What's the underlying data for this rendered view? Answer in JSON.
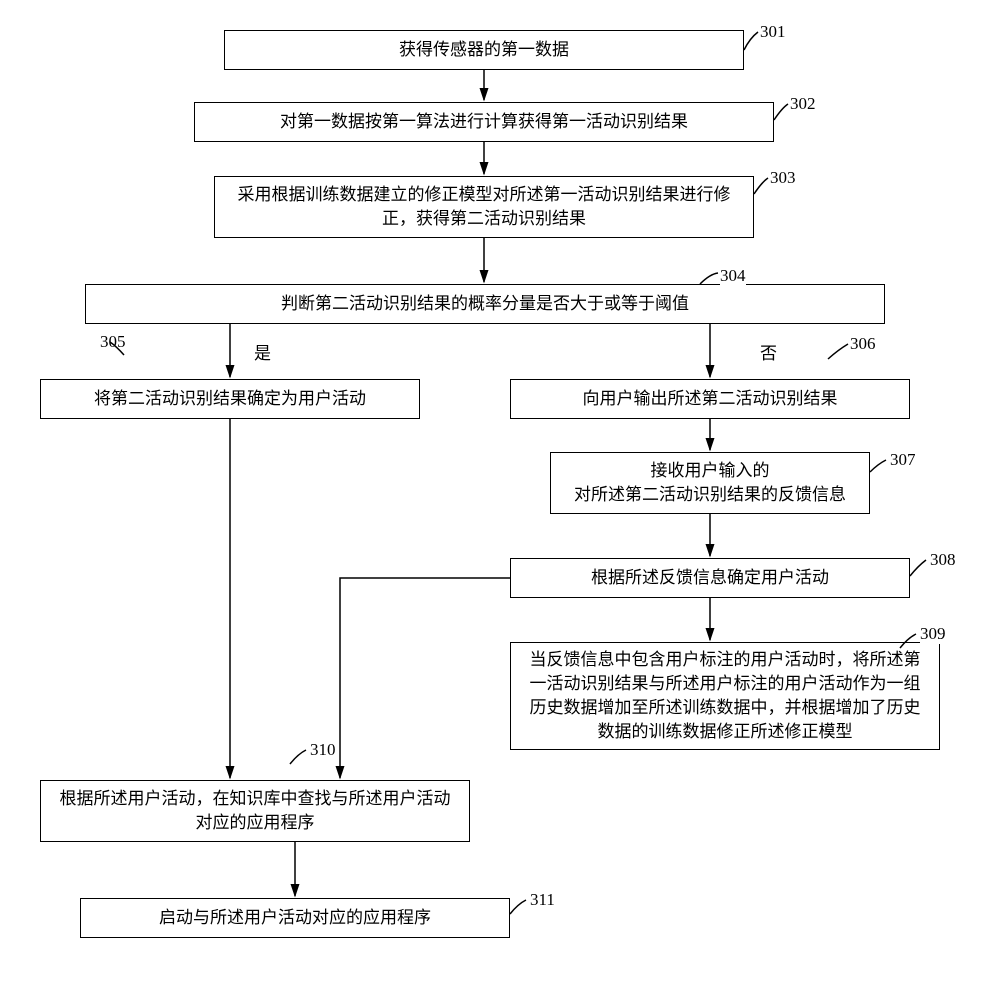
{
  "steps": {
    "s301": {
      "num": "301",
      "text": "获得传感器的第一数据"
    },
    "s302": {
      "num": "302",
      "text": "对第一数据按第一算法进行计算获得第一活动识别结果"
    },
    "s303": {
      "num": "303",
      "text": "采用根据训练数据建立的修正模型对所述第一活动识别结果进行修正，获得第二活动识别结果"
    },
    "s304": {
      "num": "304",
      "text": "判断第二活动识别结果的概率分量是否大于或等于阈值"
    },
    "s305": {
      "num": "305",
      "text": "将第二活动识别结果确定为用户活动"
    },
    "s306": {
      "num": "306",
      "text": "向用户输出所述第二活动识别结果"
    },
    "s307": {
      "num": "307",
      "text_l1": "接收用户输入的",
      "text_l2": "对所述第二活动识别结果的反馈信息"
    },
    "s308": {
      "num": "308",
      "text": "根据所述反馈信息确定用户活动"
    },
    "s309": {
      "num": "309",
      "text": "当反馈信息中包含用户标注的用户活动时，将所述第一活动识别结果与所述用户标注的用户活动作为一组历史数据增加至所述训练数据中，并根据增加了历史数据的训练数据修正所述修正模型"
    },
    "s310": {
      "num": "310",
      "text": "根据所述用户活动，在知识库中查找与所述用户活动对应的应用程序"
    },
    "s311": {
      "num": "311",
      "text": "启动与所述用户活动对应的应用程序"
    }
  },
  "branch": {
    "yes": "是",
    "no": "否"
  }
}
